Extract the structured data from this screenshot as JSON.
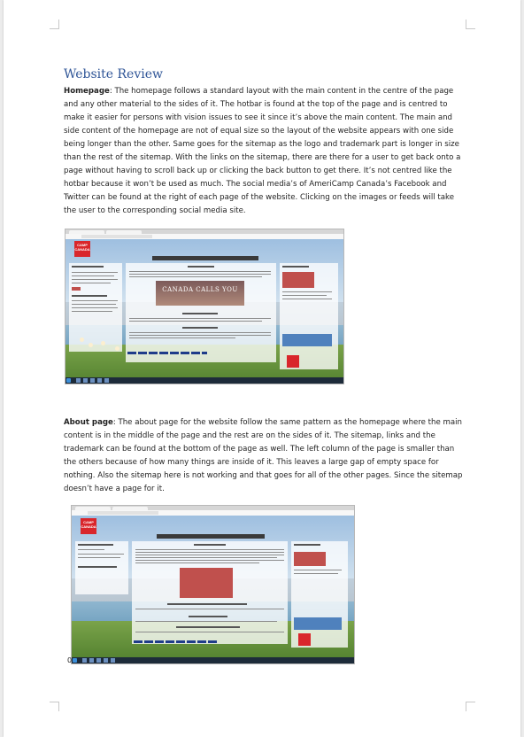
{
  "document": {
    "heading": "Website Review",
    "homepage": {
      "label": "Homepage",
      "text": ": The homepage follows a standard layout with the main content in the centre of the page and any other material to the sides of it. The hotbar is found at the top of the page and is centred to make it easier for persons with vision issues to see it since it’s above the main content. The main and side content of the homepage are not of equal size so the layout of the website appears with one side being longer than the other. Same goes for the sitemap as the logo and trademark part is longer in size than the rest of the sitemap. With the links on the sitemap, there are there for a user to get back onto a page without having to scroll back up or clicking the back button to get there. It’s not centred like the hotbar because it won’t be used as much. The social media’s of AmeriCamp Canada’s Facebook and Twitter can be found at the right of each page of the website. Clicking on the images or feeds will take the user to the corresponding social media site."
    },
    "about": {
      "label": "About page",
      "text": ": The about page for the website follow the same pattern as the homepage where the main content is in the middle of the page and the rest are on the sides of it. The sitemap, links and the trademark can be found at the bottom of the page as well. The left column of the page is smaller than the others because of how many things are inside of it. This leaves a large gap of empty space for nothing. Also the sitemap here is not working and that goes for all of the other pages. Since the sitemap doesn’t have a page for it."
    },
    "screenshot1": {
      "logo_text": "CAMP CANADA",
      "banner_text": "CANADA CALLS YOU"
    },
    "screenshot2": {
      "logo_text": "CAMP CANADA"
    },
    "stray_mark": "0"
  },
  "colors": {
    "heading": "#2f5597",
    "logo": "#d9262b",
    "link": "#1f3c8a"
  }
}
